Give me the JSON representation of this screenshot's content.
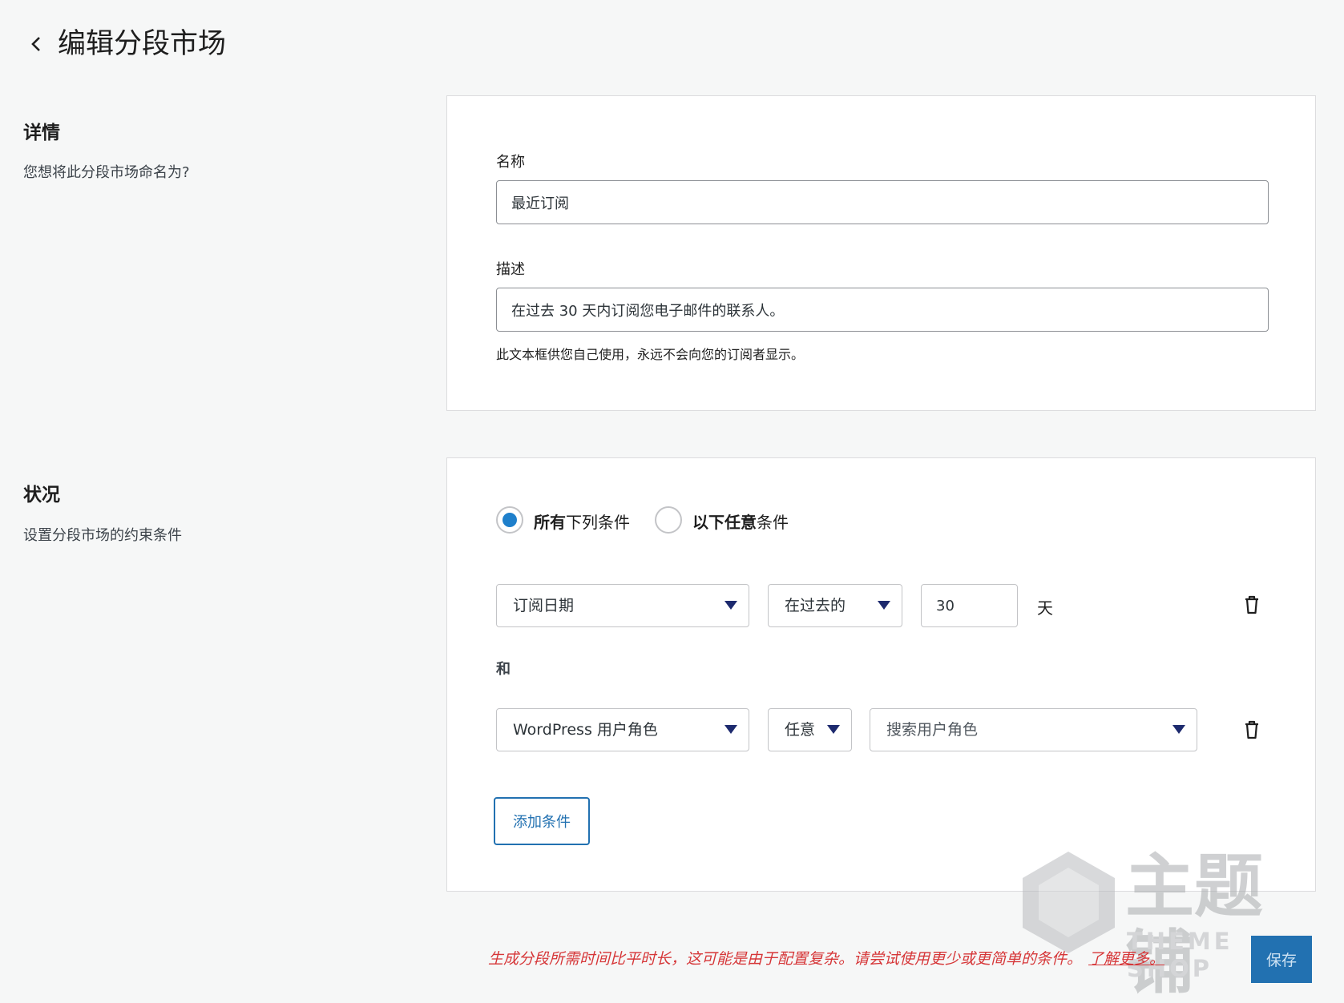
{
  "header": {
    "title": "编辑分段市场"
  },
  "details": {
    "title": "详情",
    "description": "您想将此分段市场命名为?",
    "name_label": "名称",
    "name_value": "最近订阅",
    "desc_label": "描述",
    "desc_value": "在过去 30 天内订阅您电子邮件的联系人。",
    "help_text": "此文本框供您自己使用，永远不会向您的订阅者显示。"
  },
  "conditions": {
    "title": "状况",
    "description": "设置分段市场的约束条件",
    "match_all_bold": "所有",
    "match_all_rest": "下列条件",
    "match_any_bold": "以下任意",
    "match_any_rest": "条件",
    "rule1": {
      "field": "订阅日期",
      "operator": "在过去的",
      "value": "30",
      "unit": "天"
    },
    "joiner": "和",
    "rule2": {
      "field": "WordPress 用户角色",
      "operator": "任意",
      "search_placeholder": "搜索用户角色"
    },
    "add_button": "添加条件"
  },
  "footer": {
    "warning": "生成分段所需时间比平时长，这可能是由于配置复杂。请尝试使用更少或更简单的条件。",
    "learn_more": "了解更多。",
    "save_button": "保存"
  },
  "watermark": {
    "brand": "主题铺",
    "sub": "THEME SHOP"
  },
  "colors": {
    "accent": "#2271b1",
    "radio_selected": "#1e7fcb",
    "warning": "#d63638",
    "background": "#f6f7f7"
  }
}
